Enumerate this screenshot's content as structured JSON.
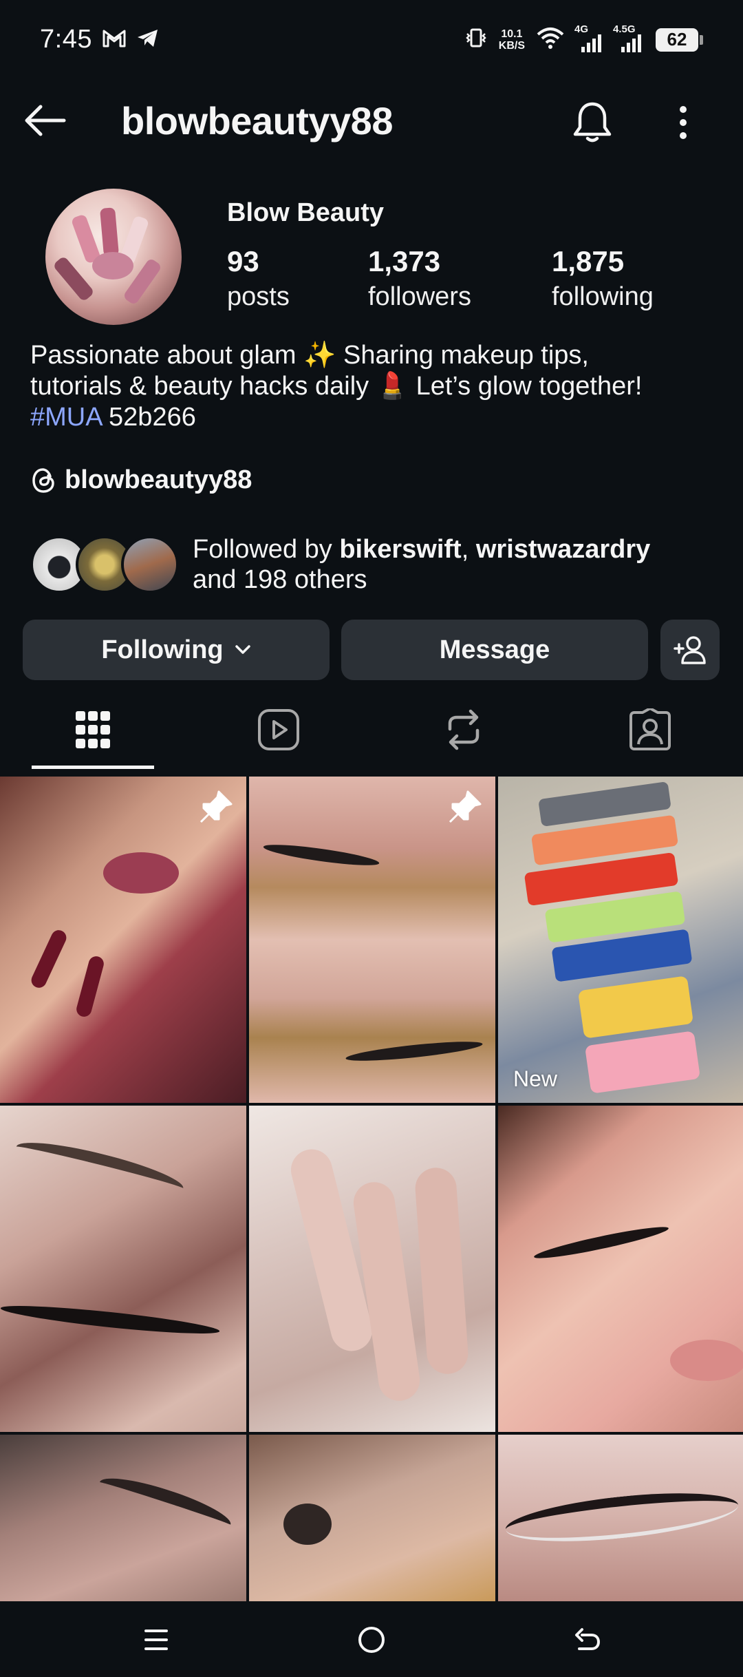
{
  "status_bar": {
    "time": "7:45",
    "net_speed_value": "10.1",
    "net_speed_unit": "KB/S",
    "signal1_label": "4G",
    "signal2_label": "4.5G",
    "battery": "62"
  },
  "header": {
    "username": "blowbeautyy88"
  },
  "profile": {
    "display_name": "Blow Beauty",
    "stats": [
      {
        "value": "93",
        "label": "posts"
      },
      {
        "value": "1,373",
        "label": "followers"
      },
      {
        "value": "1,875",
        "label": "following"
      }
    ],
    "bio_line1": "Passionate about glam ✨ Sharing makeup tips,",
    "bio_line2": "tutorials & beauty hacks daily 💄 Let’s glow together!",
    "bio_hashtag": "#MUA",
    "bio_tail": " 52b266",
    "threads_handle": "blowbeautyy88",
    "followed_prefix": "Followed by ",
    "followed_user1": "bikerswift",
    "followed_sep": ", ",
    "followed_user2": "wristwazardry",
    "followed_suffix": "and 198 others"
  },
  "actions": {
    "following_label": "Following",
    "message_label": "Message"
  },
  "grid": {
    "new_label": "New"
  },
  "colors": {
    "background": "#0c1014",
    "button": "#2b3036",
    "hashtag": "#8da7ff"
  }
}
